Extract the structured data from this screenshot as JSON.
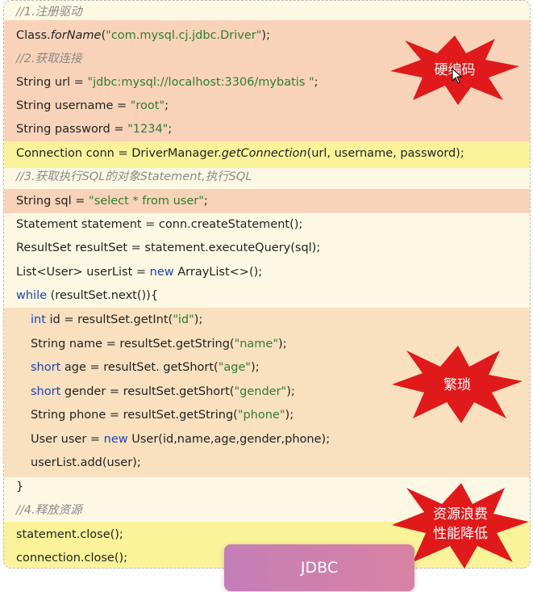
{
  "slide_title": "JDBC",
  "code": {
    "lines": [
      {
        "segs": [
          {
            "t": "//1.注册驱动"
          }
        ]
      },
      {
        "segs": [
          {
            "t": "Class."
          },
          {
            "t": "forName"
          },
          {
            "t": "("
          },
          {
            "t": "\"com.mysql.cj.jdbc.Driver\""
          },
          {
            "t": ");"
          }
        ]
      },
      {
        "segs": [
          {
            "t": "//2.获取连接"
          }
        ]
      },
      {
        "segs": [
          {
            "t": "String url = "
          },
          {
            "t": "\"jdbc:mysql://localhost:3306/mybatis \""
          },
          {
            "t": ";"
          }
        ]
      },
      {
        "segs": [
          {
            "t": "String username = "
          },
          {
            "t": "\"root\""
          },
          {
            "t": ";"
          }
        ]
      },
      {
        "segs": [
          {
            "t": "String password = "
          },
          {
            "t": "\"1234\""
          },
          {
            "t": ";"
          }
        ]
      },
      {
        "segs": [
          {
            "t": "Connection conn = DriverManager."
          },
          {
            "t": "getConnection"
          },
          {
            "t": "(url, username, password);"
          }
        ]
      },
      {
        "segs": [
          {
            "t": "//3.获取执行SQL的对象Statement,执行SQL"
          }
        ]
      },
      {
        "segs": [
          {
            "t": "String sql = "
          },
          {
            "t": "\"select * from user\""
          },
          {
            "t": ";"
          }
        ]
      },
      {
        "segs": [
          {
            "t": "Statement statement = conn.createStatement();"
          }
        ]
      },
      {
        "segs": [
          {
            "t": "ResultSet resultSet = statement.executeQuery(sql);"
          }
        ]
      },
      {
        "segs": [
          {
            "t": "List<User> userList = "
          },
          {
            "t": "new"
          },
          {
            "t": " ArrayList<>();"
          }
        ]
      },
      {
        "segs": [
          {
            "t": "while"
          },
          {
            "t": " (resultSet.next()){"
          }
        ]
      },
      {
        "segs": [
          {
            "t": "int"
          },
          {
            "t": " id = resultSet.getInt("
          },
          {
            "t": "\"id\""
          },
          {
            "t": ");"
          }
        ]
      },
      {
        "segs": [
          {
            "t": "String name = resultSet.getString("
          },
          {
            "t": "\"name\""
          },
          {
            "t": ");"
          }
        ]
      },
      {
        "segs": [
          {
            "t": "short"
          },
          {
            "t": " age = resultSet. getShort("
          },
          {
            "t": "\"age\""
          },
          {
            "t": ");"
          }
        ]
      },
      {
        "segs": [
          {
            "t": "short"
          },
          {
            "t": " gender = resultSet.getShort("
          },
          {
            "t": "\"gender\""
          },
          {
            "t": ");"
          }
        ]
      },
      {
        "segs": [
          {
            "t": "String phone = resultSet.getString("
          },
          {
            "t": "\"phone\""
          },
          {
            "t": ");"
          }
        ]
      },
      {
        "segs": [
          {
            "t": "User user = "
          },
          {
            "t": "new"
          },
          {
            "t": " User(id,name,age,gender,phone);"
          }
        ]
      },
      {
        "segs": [
          {
            "t": "userList.add(user);"
          }
        ]
      },
      {
        "segs": [
          {
            "t": "}"
          }
        ]
      },
      {
        "segs": [
          {
            "t": "//4.释放资源"
          }
        ]
      },
      {
        "segs": [
          {
            "t": "statement.close();"
          }
        ]
      },
      {
        "segs": [
          {
            "t": "connection.close();"
          }
        ]
      }
    ]
  },
  "annotations": {
    "hardcode": {
      "label": "硬编码"
    },
    "verbose": {
      "label": "繁琐"
    },
    "waste": {
      "label1": "资源浪费",
      "label2": "性能降低"
    }
  },
  "colors": {
    "panel_bg": "#fdf8e4",
    "band_hardcode": "#f9d3b9",
    "band_connection": "#fbf39a",
    "band_loop": "#f9e0bf",
    "band_release": "#fbf39a",
    "burst_red": "#e0191a",
    "string_green": "#2e7d32",
    "keyword_blue": "#1a45b5",
    "comment_gray": "#8a8a8a",
    "tag_gradient_start": "#c47fb8",
    "tag_gradient_end": "#d882a2"
  }
}
